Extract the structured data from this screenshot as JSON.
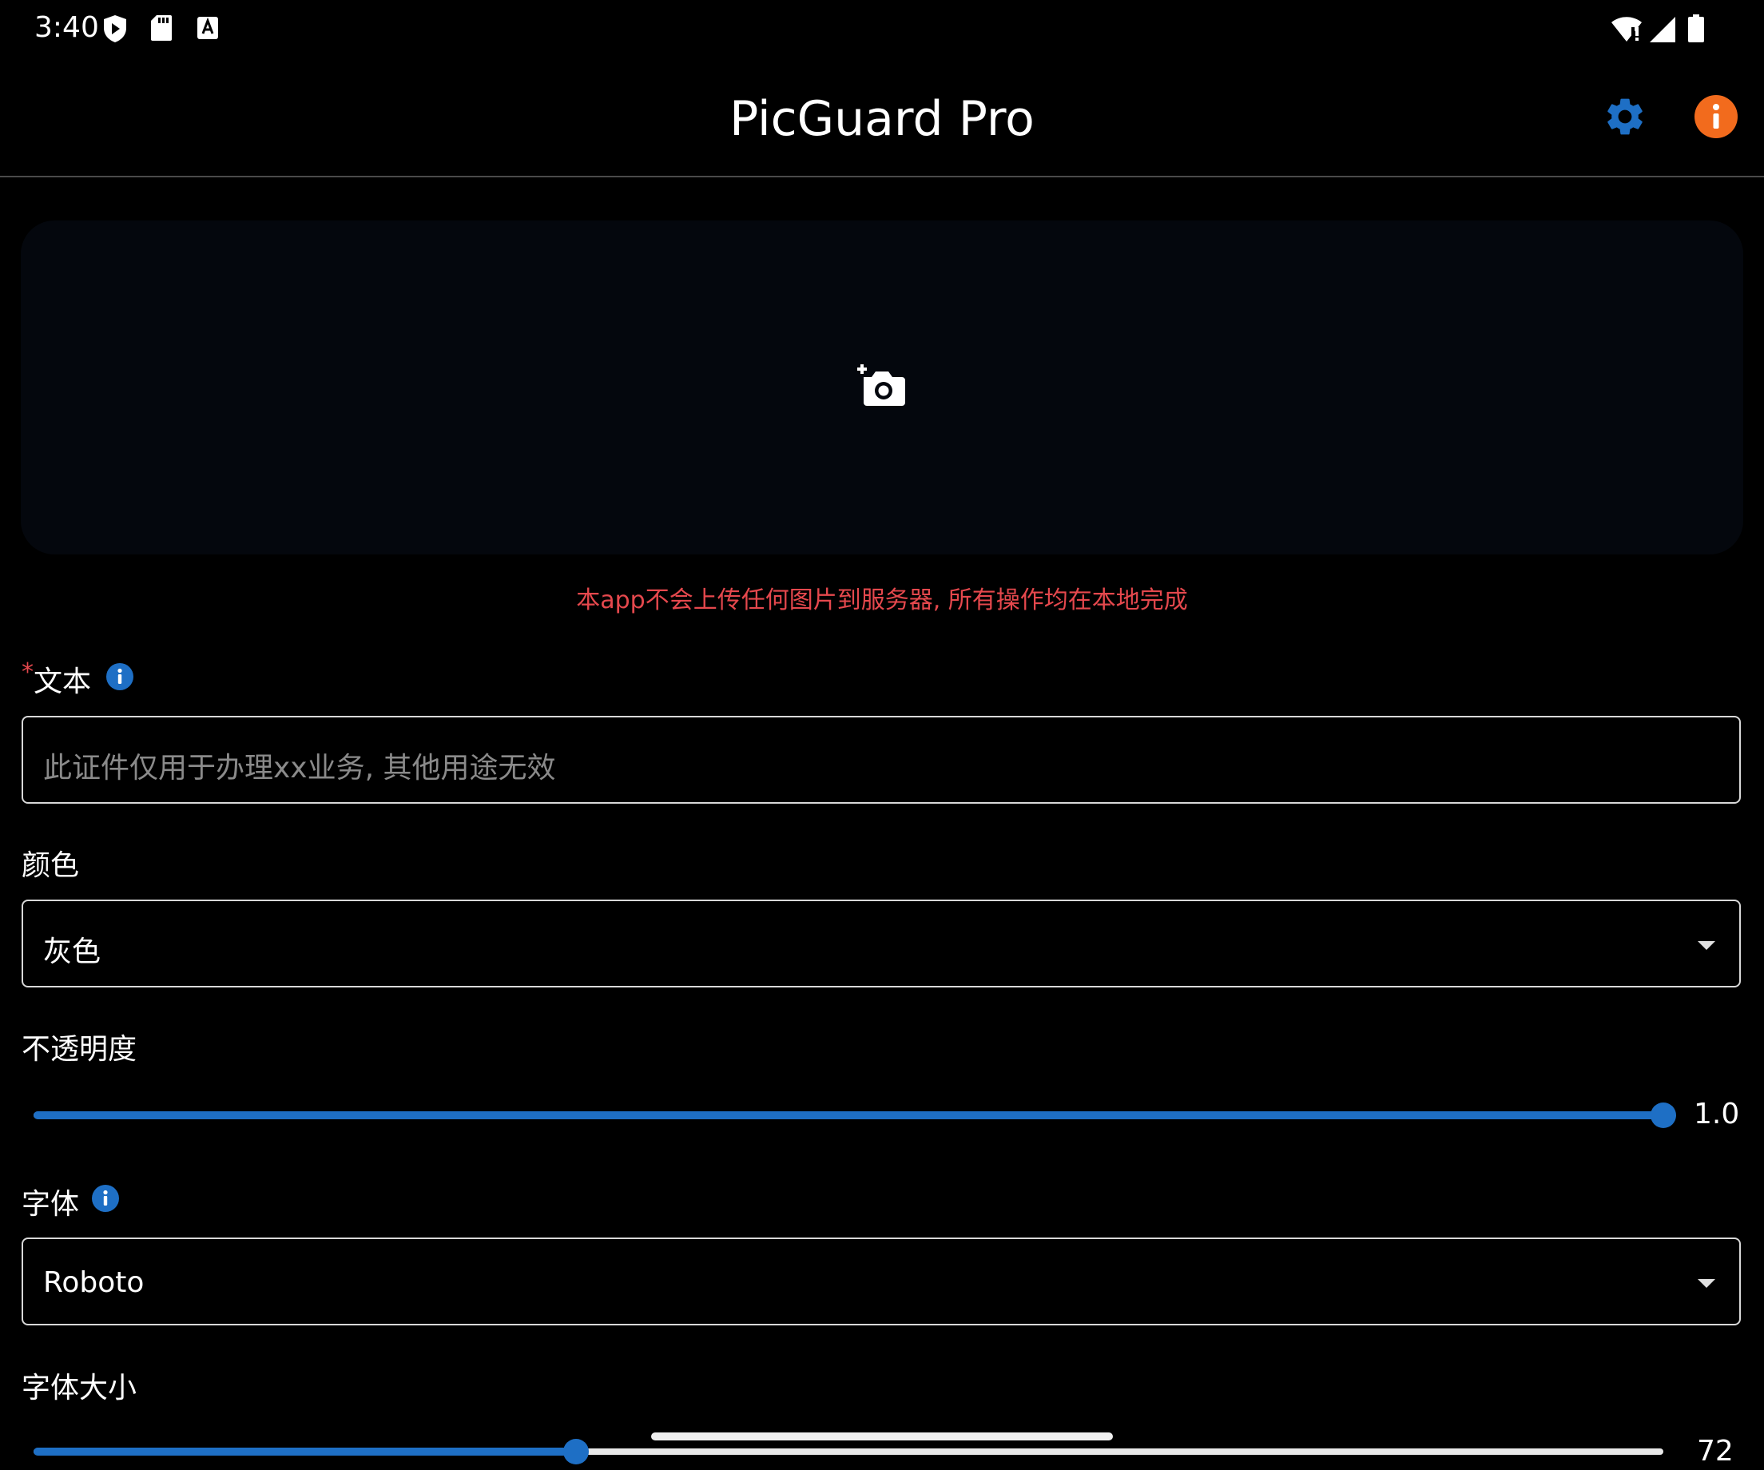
{
  "status_bar": {
    "time": "3:40",
    "left_icons": [
      "shield-play-icon",
      "sd-card-icon",
      "keyboard-a-icon"
    ],
    "right_icons": [
      "wifi-alert-icon",
      "cell-signal-icon",
      "battery-icon"
    ]
  },
  "app_bar": {
    "title": "PicGuard Pro",
    "settings_icon": "gear-icon",
    "info_icon": "info-icon",
    "accent_blue": "#1e6fc5",
    "accent_orange": "#f26b1d"
  },
  "image_picker": {
    "icon": "add-photo-camera-icon"
  },
  "privacy_notice": "本app不会上传任何图片到服务器, 所有操作均在本地完成",
  "form": {
    "text": {
      "required_mark": "*",
      "label": "文本",
      "placeholder": "此证件仅用于办理xx业务, 其他用途无效",
      "value": ""
    },
    "color": {
      "label": "颜色",
      "selected": "灰色"
    },
    "opacity": {
      "label": "不透明度",
      "value": 1.0,
      "display": "1.0",
      "fraction": 1.0
    },
    "font": {
      "label": "字体",
      "selected": "Roboto"
    },
    "font_size": {
      "label": "字体大小",
      "value": 72,
      "display": "72",
      "fraction": 0.333
    }
  }
}
